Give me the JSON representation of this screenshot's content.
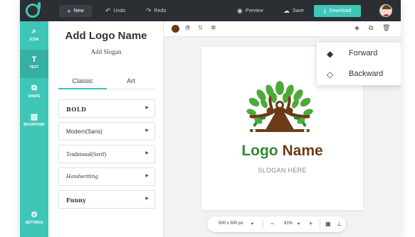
{
  "topbar": {
    "new_label": "New",
    "undo_label": "Undo",
    "redo_label": "Redo",
    "preview_label": "Preview",
    "save_label": "Save",
    "download_label": "Download"
  },
  "sidebar": {
    "items": [
      {
        "label": "ICON",
        "icon": "search-icon"
      },
      {
        "label": "TEXT",
        "icon": "text-icon"
      },
      {
        "label": "SHAPE",
        "icon": "shape-icon"
      },
      {
        "label": "BKGROUND",
        "icon": "background-icon"
      },
      {
        "label": "SETTINGS",
        "icon": "gear-icon"
      }
    ]
  },
  "panel": {
    "title": "Add Logo Name",
    "slogan": "Add Slogan",
    "tabs": [
      "Classic",
      "Art"
    ],
    "fonts": [
      "BOLD",
      "Modern(Sans)",
      "Traditional(Serif)",
      "Handwriting",
      "Funny"
    ]
  },
  "colors": {
    "accent": "#3ec6b7",
    "topbar": "#2b2e33",
    "selected_color": "#6b3a17",
    "logo_green": "#2f8a32",
    "logo_brown": "#6b3a17"
  },
  "canvas": {
    "logo_word1": "Logo",
    "logo_word2": "Name",
    "slogan": "SLOGAN HERE"
  },
  "layer_menu": {
    "forward_label": "Forward",
    "backward_label": "Backward"
  },
  "bottom_bar": {
    "size_label": "500 x 500 px",
    "zoom_minus": "−",
    "zoom_label": "91%",
    "zoom_plus": "+"
  }
}
